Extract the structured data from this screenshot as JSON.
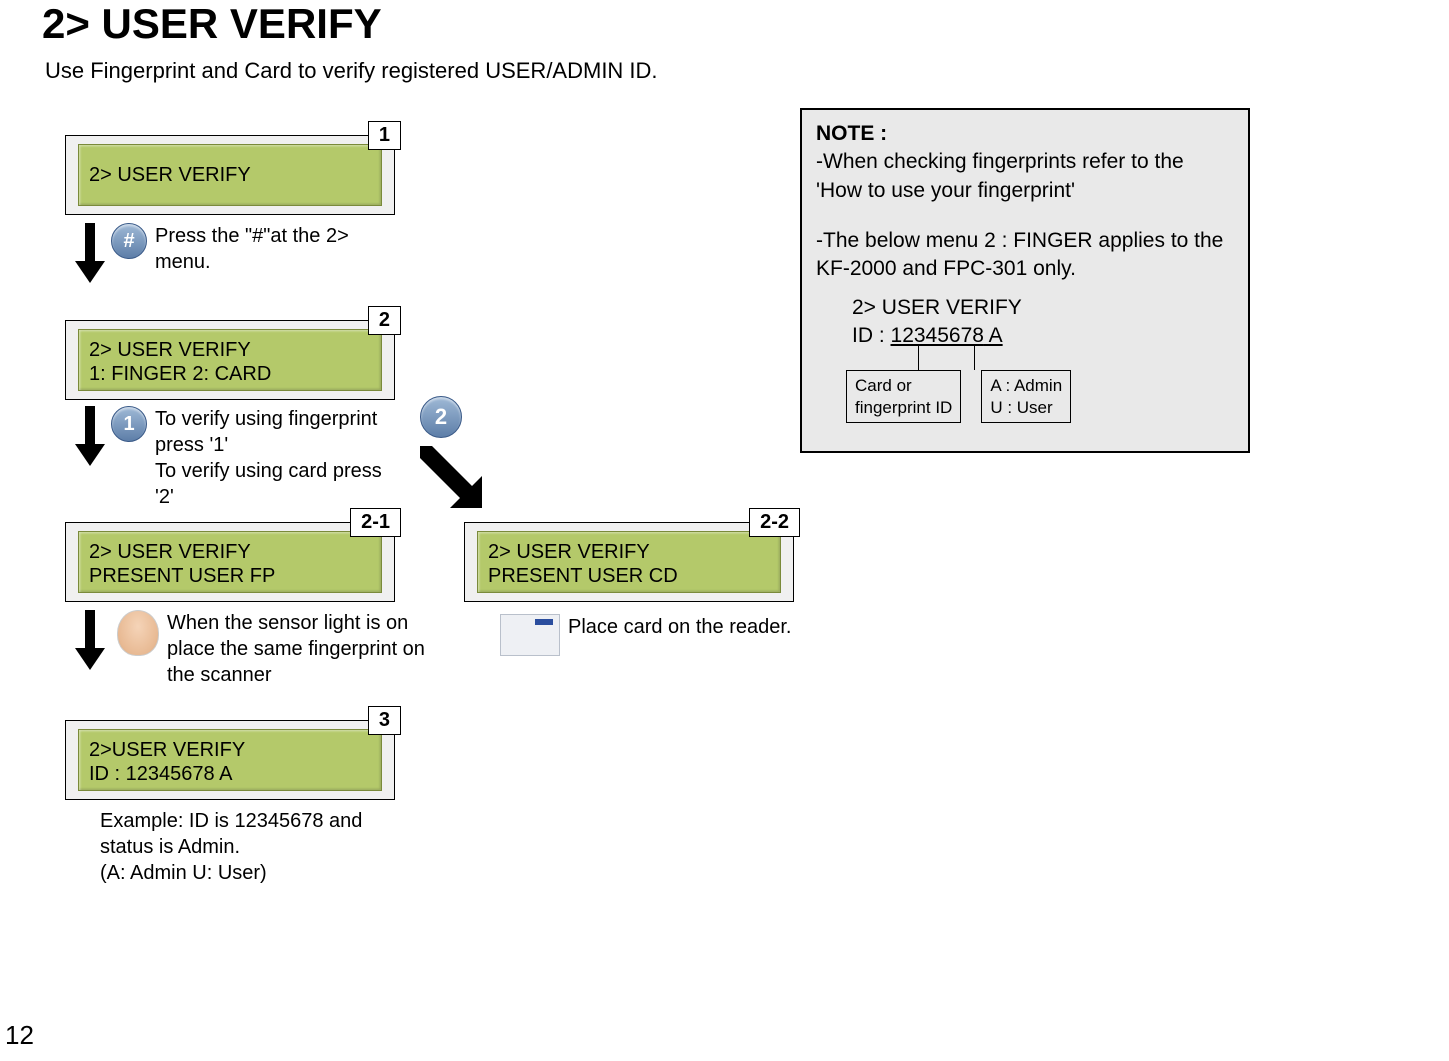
{
  "page": {
    "title": "2> USER VERIFY",
    "subtitle": "Use Fingerprint and Card to verify registered USER/ADMIN ID.",
    "number": "12"
  },
  "steps": {
    "s1": {
      "badge": "1",
      "lcd_line1": "2> USER VERIFY",
      "key": "#",
      "instruction": "Press the \"#\"at the 2> menu."
    },
    "s2": {
      "badge": "2",
      "lcd_line1": "2> USER VERIFY",
      "lcd_line2": "1: FINGER    2: CARD",
      "key_left": "1",
      "key_right": "2",
      "instruction": "To verify using fingerprint press '1'\nTo verify using card press '2'"
    },
    "s2_1": {
      "badge": "2-1",
      "lcd_line1": "2> USER VERIFY",
      "lcd_line2": "PRESENT USER FP",
      "instruction": "When the sensor light is on place the same fingerprint on the scanner"
    },
    "s2_2": {
      "badge": "2-2",
      "lcd_line1": "2> USER VERIFY",
      "lcd_line2": "PRESENT USER CD",
      "instruction": "Place card on the reader."
    },
    "s3": {
      "badge": "3",
      "lcd_line1": "2>USER VERIFY",
      "lcd_line2": "ID : 12345678 A",
      "under_text": "Example: ID is 12345678 and status is Admin.\n(A: Admin   U: User)"
    }
  },
  "note": {
    "heading": "NOTE :",
    "line1": "-When checking fingerprints refer to the 'How to use your fingerprint'",
    "line2": "-The below menu 2 : FINGER applies to the KF-2000 and  FPC-301 only.",
    "id_line1": "2> USER VERIFY",
    "id_prefix": "ID : ",
    "id_value": "12345678",
    "id_suffix": " A",
    "callout_left": "Card or\nfingerprint ID",
    "callout_right": "A : Admin\nU : User"
  }
}
